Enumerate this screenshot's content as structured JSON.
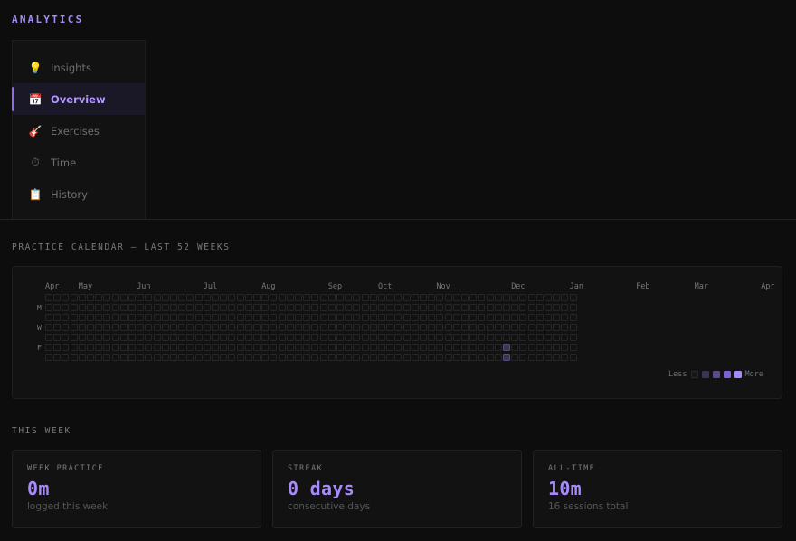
{
  "app": {
    "title": "ANALYTICS"
  },
  "sidebar": {
    "items": [
      {
        "label": "Insights",
        "icon": "lightbulb-icon",
        "glyph": "💡",
        "active": false
      },
      {
        "label": "Overview",
        "icon": "calendar-icon",
        "glyph": "📅",
        "active": true
      },
      {
        "label": "Exercises",
        "icon": "guitar-icon",
        "glyph": "🎸",
        "active": false
      },
      {
        "label": "Time",
        "icon": "stopwatch-icon",
        "glyph": "⏱",
        "active": false
      },
      {
        "label": "History",
        "icon": "clipboard-icon",
        "glyph": "📋",
        "active": false
      }
    ]
  },
  "calendar": {
    "title": "PRACTICE CALENDAR — LAST 52 WEEKS",
    "months": [
      "Apr",
      "May",
      "Jun",
      "Jul",
      "Aug",
      "Sep",
      "Oct",
      "Nov",
      "Dec",
      "Jan",
      "Feb",
      "Mar",
      "Apr"
    ],
    "month_week_index": [
      0,
      4,
      11,
      19,
      26,
      34,
      40,
      47,
      56,
      63,
      71,
      78,
      86
    ],
    "day_labels": [
      {
        "day": 1,
        "label": "M"
      },
      {
        "day": 3,
        "label": "W"
      },
      {
        "day": 5,
        "label": "F"
      }
    ],
    "weeks_drawn": 64,
    "active_cells": [
      {
        "week": 55,
        "day": 5,
        "level": 1
      },
      {
        "week": 55,
        "day": 6,
        "level": 1
      }
    ],
    "legend": {
      "less": "Less",
      "more": "More",
      "colors": [
        "#161616",
        "#3c3452",
        "#5a4a8c",
        "#7c62d1",
        "#a78bfa"
      ]
    }
  },
  "this_week": {
    "title": "THIS WEEK",
    "cards": [
      {
        "label": "WEEK PRACTICE",
        "value": "0m",
        "sub": "logged this week"
      },
      {
        "label": "STREAK",
        "value": "0 days",
        "sub": "consecutive days"
      },
      {
        "label": "ALL-TIME",
        "value": "10m",
        "sub": "16 sessions total"
      }
    ]
  },
  "colors": {
    "accent": "#a78bfa",
    "background": "#0d0d0d",
    "panel": "#121212"
  }
}
